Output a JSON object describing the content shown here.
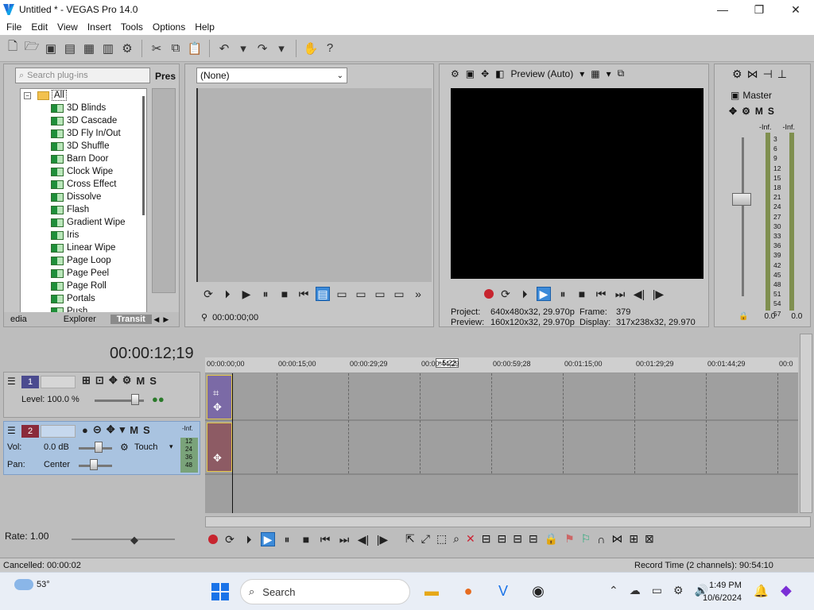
{
  "window": {
    "title": "Untitled * - VEGAS Pro 14.0",
    "minimize": "—",
    "maximize": "❐",
    "close": "✕"
  },
  "menu": [
    "File",
    "Edit",
    "View",
    "Insert",
    "Tools",
    "Options",
    "Help"
  ],
  "plugin_chooser": {
    "search_placeholder": "Search plug-ins",
    "presets_label": "Pres",
    "root": "All",
    "items": [
      "3D Blinds",
      "3D Cascade",
      "3D Fly In/Out",
      "3D Shuffle",
      "Barn Door",
      "Clock Wipe",
      "Cross Effect",
      "Dissolve",
      "Flash",
      "Gradient Wipe",
      "Iris",
      "Linear Wipe",
      "Page Loop",
      "Page Peel",
      "Page Roll",
      "Portals",
      "Push"
    ],
    "tabs": [
      "edia",
      "Explorer",
      "Transit"
    ]
  },
  "trimmer": {
    "preset": "(None)",
    "timecode": "00:00:00;00"
  },
  "preview": {
    "quality": "Preview (Auto)",
    "project_label": "Project:",
    "project_value": "640x480x32, 29.970p",
    "frame_label": "Frame:",
    "frame_value": "379",
    "preview_label": "Preview:",
    "preview_value": "160x120x32, 29.970p",
    "display_label": "Display:",
    "display_value": "317x238x32, 29.970"
  },
  "master": {
    "label": "Master",
    "m": "M",
    "s": "S",
    "inf_left": "-Inf.",
    "inf_right": "-Inf.",
    "scale": [
      "3",
      "6",
      "9",
      "12",
      "15",
      "18",
      "21",
      "24",
      "27",
      "30",
      "33",
      "36",
      "39",
      "42",
      "45",
      "48",
      "51",
      "54",
      "57"
    ],
    "level_left": "0.0",
    "level_right": "0.0"
  },
  "timeline": {
    "time": "00:00:12;19",
    "marker": "+5:22",
    "ruler": [
      "00:00:00;00",
      "00:00:15;00",
      "00:00:29;29",
      "00:00:44;29",
      "00:00:59;28",
      "00:01:15;00",
      "00:01:29;29",
      "00:01:44;29",
      "00:0"
    ],
    "video_track": {
      "number": "1",
      "level": "Level: 100.0 %",
      "m": "M",
      "s": "S"
    },
    "audio_track": {
      "number": "2",
      "vol_label": "Vol:",
      "vol_value": "0.0 dB",
      "pan_label": "Pan:",
      "pan_value": "Center",
      "automation": "Touch",
      "m": "M",
      "s": "S",
      "meter_top": "-Inf.",
      "meter_scale": [
        "12",
        "24",
        "36",
        "48"
      ]
    }
  },
  "bottom": {
    "rate": "Rate: 1.00"
  },
  "status": {
    "left": "Cancelled: 00:00:02",
    "right": "Record Time (2 channels): 90:54:10"
  },
  "taskbar": {
    "temperature": "53°",
    "search": "Search",
    "time": "1:49 PM",
    "date": "10/6/2024"
  },
  "colors": {
    "track_audio_header": "#a9c3e0",
    "video_event": "#7b6aa6",
    "audio_event": "#8d5b64",
    "play_active": "#3d8bd9"
  }
}
